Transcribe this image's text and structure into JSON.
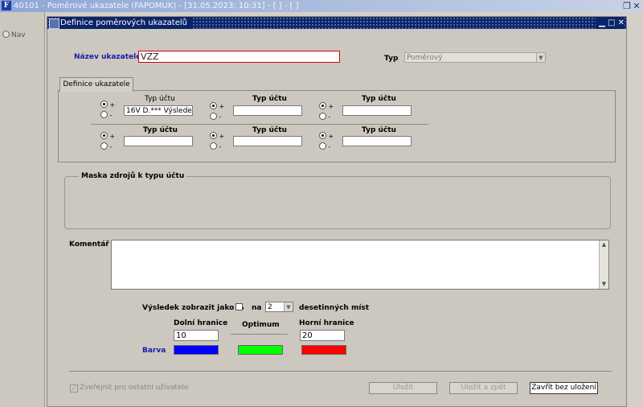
{
  "app": {
    "title": "40101 - Poměrové ukazatele (FAPOMUK) - [31.05.2023; 10:31] - [ ] - [ ]",
    "nav_label": "Nav"
  },
  "window": {
    "title": "Definice poměrových ukazatelů"
  },
  "form": {
    "name_label": "Název ukazatele",
    "name_value": "VZZ",
    "type_label": "Typ",
    "type_value": "Poměrový"
  },
  "tab": {
    "label": "Definice ukazatele"
  },
  "account_types": {
    "header": "Typ účtu",
    "plus": "+",
    "minus": "-",
    "row1": [
      {
        "value": "16V D.*** Výsledek h",
        "selected": "plus"
      },
      {
        "value": "",
        "selected": "plus"
      },
      {
        "value": "",
        "selected": "plus"
      }
    ],
    "row2": [
      {
        "value": "",
        "selected": "plus"
      },
      {
        "value": "",
        "selected": "plus"
      },
      {
        "value": "",
        "selected": "plus"
      }
    ]
  },
  "mask": {
    "title": "Maska zdrojů k typu účtu"
  },
  "comment": {
    "label": "Komentář",
    "value": ""
  },
  "result": {
    "label": "Výsledek zobrazit jako %",
    "checked": false,
    "na_label": "na",
    "decimals": "2",
    "decimals_suffix": "desetinných míst"
  },
  "bounds": {
    "lower_label": "Dolní hranice",
    "lower_value": "10",
    "optimum_label": "Optimum",
    "upper_label": "Horní hranice",
    "upper_value": "20",
    "color_label": "Barva",
    "colors": {
      "lower": "#0000ff",
      "optimum": "#00ff00",
      "upper": "#ff0000"
    }
  },
  "footer": {
    "publish_label": "Zveřejnit pro ostatní uživatele",
    "save_label": "Uložit",
    "save_back_label": "Uložit a zpět",
    "close_label": "Zavřít bez uložení"
  }
}
